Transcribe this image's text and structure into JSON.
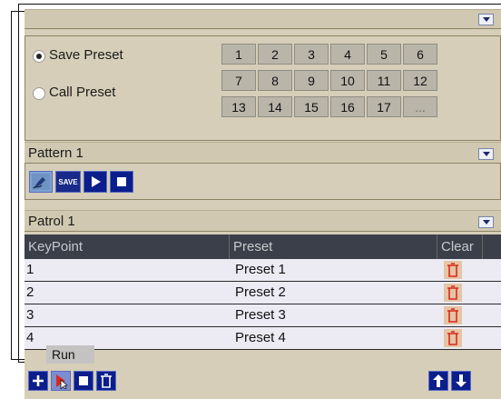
{
  "preset_section": {
    "options": [
      {
        "label": "Save Preset",
        "selected": true
      },
      {
        "label": "Call Preset",
        "selected": false
      }
    ],
    "numbers": [
      "1",
      "2",
      "3",
      "4",
      "5",
      "6",
      "7",
      "8",
      "9",
      "10",
      "11",
      "12",
      "13",
      "14",
      "15",
      "16",
      "17",
      "..."
    ]
  },
  "pattern_section": {
    "title": "Pattern 1",
    "buttons": [
      {
        "name": "pen-icon"
      },
      {
        "name": "save-button",
        "label": "SAVE"
      },
      {
        "name": "play-icon"
      },
      {
        "name": "stop-icon"
      }
    ]
  },
  "patrol_section": {
    "title": "Patrol 1",
    "columns": [
      "KeyPoint",
      "Preset",
      "Clear"
    ],
    "rows": [
      {
        "keypoint": "1",
        "preset": "Preset 1"
      },
      {
        "keypoint": "2",
        "preset": "Preset 2"
      },
      {
        "keypoint": "3",
        "preset": "Preset 3"
      },
      {
        "keypoint": "4",
        "preset": "Preset 4"
      }
    ],
    "tooltip": "Run"
  },
  "bottom_toolbar": {
    "left_icons": [
      "add-icon",
      "run-icon",
      "stop-icon",
      "delete-icon"
    ],
    "right_icons": [
      "arrow-up-icon",
      "arrow-down-icon"
    ]
  },
  "colors": {
    "panel_bg": "#d6ceb8",
    "button_blue": "#0b1e8c",
    "table_header": "#3a3f49",
    "trash_red": "#d62b1a"
  }
}
